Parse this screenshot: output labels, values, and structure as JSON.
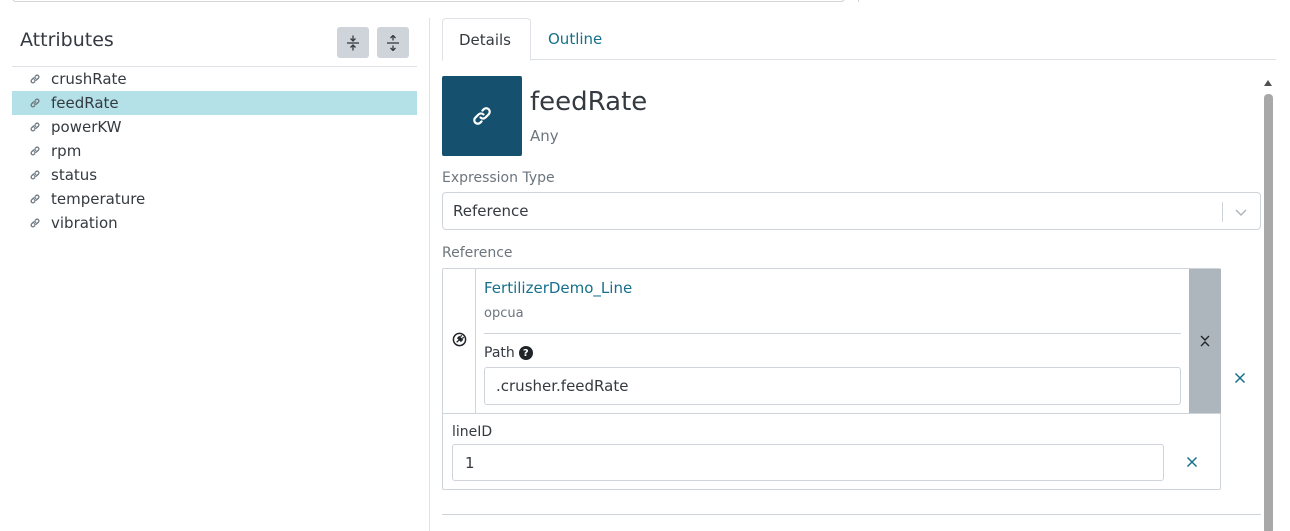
{
  "attributes_panel": {
    "title": "Attributes",
    "collapse_all_icon": "collapse-vertical-icon",
    "expand_all_icon": "expand-vertical-icon",
    "items": [
      {
        "label": "crushRate",
        "icon": "link-icon"
      },
      {
        "label": "feedRate",
        "icon": "link-icon",
        "selected": true
      },
      {
        "label": "powerKW",
        "icon": "link-icon"
      },
      {
        "label": "rpm",
        "icon": "link-icon"
      },
      {
        "label": "status",
        "icon": "link-icon"
      },
      {
        "label": "temperature",
        "icon": "link-icon"
      },
      {
        "label": "vibration",
        "icon": "link-icon"
      }
    ]
  },
  "tabs": [
    {
      "label": "Details",
      "active": true
    },
    {
      "label": "Outline",
      "active": false
    }
  ],
  "details": {
    "name": "feedRate",
    "type": "Any",
    "tile_icon": "link-icon",
    "expression_type": {
      "label": "Expression Type",
      "value": "Reference"
    },
    "reference": {
      "label": "Reference",
      "source_icon": "plug-icon",
      "source_name": "FertilizerDemo_Line",
      "source_type": "opcua",
      "path_label": "Path",
      "path_value": ".crusher.feedRate",
      "param_label": "lineID",
      "param_value": "1"
    }
  },
  "colors": {
    "accent": "#17708b",
    "tile": "#15506e",
    "selected_row": "#b4e1e8"
  }
}
